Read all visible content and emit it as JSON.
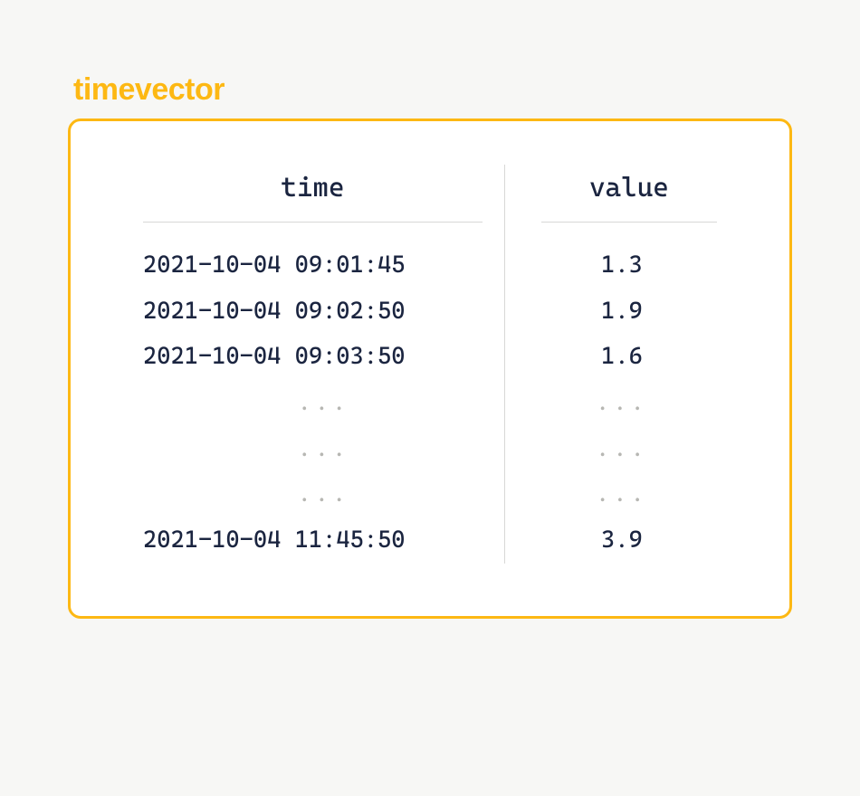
{
  "title": "timevector",
  "columns": {
    "time_header": "time",
    "value_header": "value"
  },
  "rows": [
    {
      "time": "2021-10-04 09:01:45",
      "value": "1.3"
    },
    {
      "time": "2021-10-04 09:02:50",
      "value": "1.9"
    },
    {
      "time": "2021-10-04 09:03:50",
      "value": "1.6"
    }
  ],
  "ellipsis": "...",
  "last_row": {
    "time": "2021-10-04 11:45:50",
    "value": "3.9"
  }
}
